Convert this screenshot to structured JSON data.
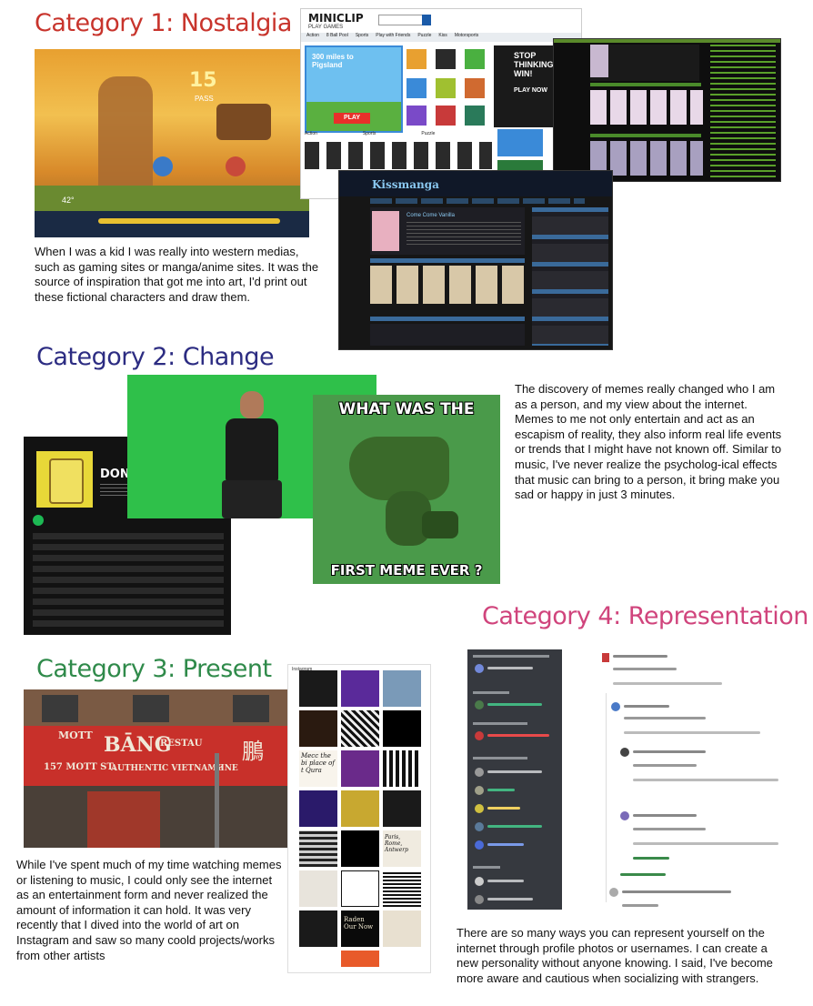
{
  "colors": {
    "cat1": "#c8342c",
    "cat2": "#2c2c82",
    "cat3": "#2f8a4a",
    "cat4": "#d0447c"
  },
  "sections": [
    {
      "title": "Category 1: Nostalgia",
      "text": "When I was a kid I was really into western medias, such as gaming sites or manga/anime sites. It was the source of inspiration that got me into art, I'd print out these fictional characters and draw them."
    },
    {
      "title": "Category 2: Change",
      "text": "The discovery of memes really changed who I am as a person, and my view about the internet. Memes to me not only entertain and act as an escapism of reality, they also inform real life events or trends that I might have not known off. Similar to music, I've never realize the psycholog-ical effects that music can bring to a person, it bring make you sad or happy in just 3 minutes."
    },
    {
      "title": "Category 3: Present",
      "text": "While I've spent much of my time watching memes or listening to music, I could only see the internet as an entertainment form and never realized the amount of information it can hold. It was very recently that I dived into the world of art on Instagram and saw so many coold projects/works from other artists"
    },
    {
      "title": "Category 4: Representation",
      "text": "There are so many ways you can represent yourself on the internet through profile photos or usernames. I can create a new personality without anyone knowing. I said, I've become more aware and cautious when socializing with strangers."
    }
  ],
  "screens": {
    "game_hud": {
      "number": "15",
      "pass": "PASS",
      "angle": "42°"
    },
    "miniclip": {
      "logo": "MINICLIP",
      "sub": "PLAY GAMES",
      "nav": [
        "Action",
        "8 Ball Pool",
        "Sports",
        "Play with Friends",
        "Puzzle",
        "Kiss",
        "Motorsports"
      ],
      "banner": "300 miles to Pigsland",
      "play": "PLAY",
      "promo": "STOP THINKING! WIN!",
      "play_now": "PLAY NOW",
      "sections": [
        "Action",
        "Sports",
        "Puzzle"
      ]
    },
    "kissmanga": {
      "logo": "Kissmanga",
      "featured": "Come Come Vanilla"
    },
    "spotify": {
      "title": "DON'T KI"
    },
    "meme": {
      "top": "WHAT WAS THE",
      "bottom": "FIRST MEME EVER ?"
    },
    "storefront": {
      "sign1": "MOTT",
      "sign2": "BĀNG",
      "sign3": "RESTAU",
      "addr": "157 MOTT ST.",
      "sub": "AUTHENTIC  VIETNAME",
      "sub2": "SINE",
      "chinese": "鵬"
    },
    "instagram": {
      "label": "Instagram",
      "tile_a": "Mecc the bi place of t Qura",
      "tile_b": "Paris, Rome, Antwerp",
      "tile_c": "Raden Our Now"
    }
  }
}
